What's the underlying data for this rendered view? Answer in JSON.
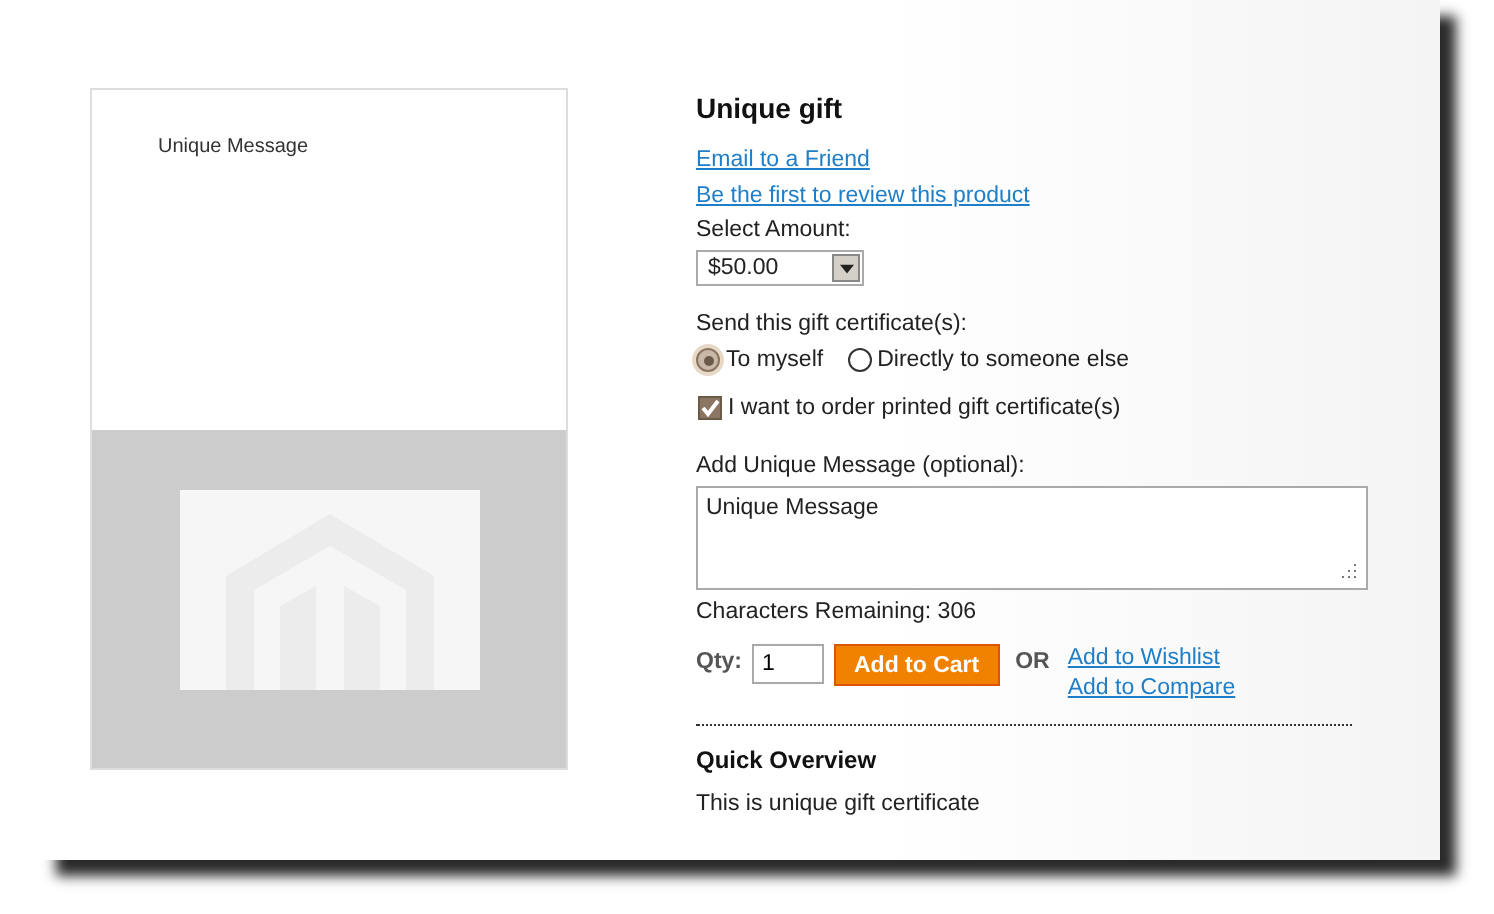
{
  "preview": {
    "message": "Unique Message"
  },
  "product": {
    "title": "Unique gift",
    "links": [
      "Email to a Friend",
      "Be the first to review this product"
    ],
    "amount": {
      "label": "Select Amount:",
      "value": "$50.00"
    },
    "send": {
      "label": "Send this gift certificate(s):",
      "options": [
        {
          "label": "To myself",
          "selected": true
        },
        {
          "label": "Directly to someone else",
          "selected": false
        }
      ]
    },
    "printed": {
      "label": "I want to order printed gift certificate(s)",
      "checked": true
    },
    "message": {
      "label": "Add Unique Message (optional):",
      "value": "Unique Message"
    },
    "remaining": "Characters Remaining: 306",
    "qty": {
      "label": "Qty:",
      "value": "1"
    },
    "add_button": "Add to Cart",
    "or": "OR",
    "actions": [
      "Add to Wishlist",
      "Add to Compare"
    ],
    "overview": {
      "title": "Quick Overview",
      "text": "This is unique gift certificate"
    }
  }
}
